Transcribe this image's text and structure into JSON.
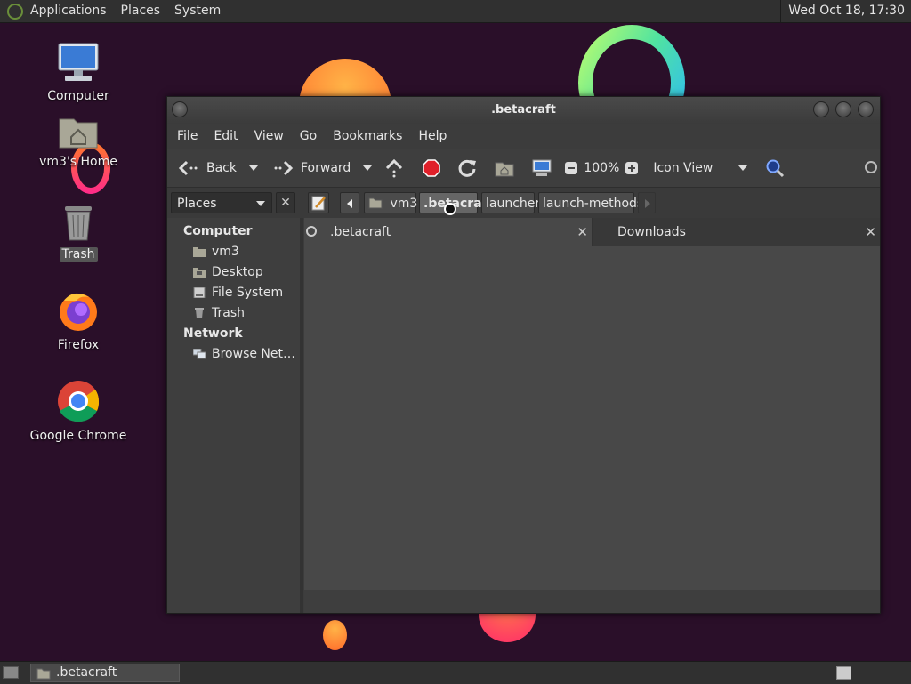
{
  "top_panel": {
    "menus": [
      "Applications",
      "Places",
      "System"
    ],
    "clock": "Wed Oct 18, 17:30"
  },
  "desktop_icons": [
    {
      "label": "Computer"
    },
    {
      "label": "vm3's Home"
    },
    {
      "label": "Trash"
    },
    {
      "label": "Firefox"
    },
    {
      "label": "Google Chrome"
    }
  ],
  "window": {
    "title": ".betacraft",
    "menubar": [
      "File",
      "Edit",
      "View",
      "Go",
      "Bookmarks",
      "Help"
    ],
    "toolbar": {
      "back": "Back",
      "forward": "Forward",
      "zoom": "100%",
      "view_mode": "Icon View"
    },
    "location": {
      "places_selector": "Places",
      "breadcrumbs": [
        "vm3",
        ".betacraft",
        "launcher",
        "launch-methods"
      ]
    },
    "sidebar": {
      "computer_header": "Computer",
      "computer_items": [
        "vm3",
        "Desktop",
        "File System",
        "Trash"
      ],
      "network_header": "Network",
      "network_items": [
        "Browse Net…"
      ]
    },
    "tabs": [
      {
        "label": ".betacraft",
        "active": true
      },
      {
        "label": "Downloads",
        "active": false
      }
    ]
  },
  "bottom_panel": {
    "task": ".betacraft"
  },
  "colors": {
    "desktop_bg": "#2a0f29",
    "window_bg": "#3c3c3c",
    "stop_red": "#e0202a"
  }
}
